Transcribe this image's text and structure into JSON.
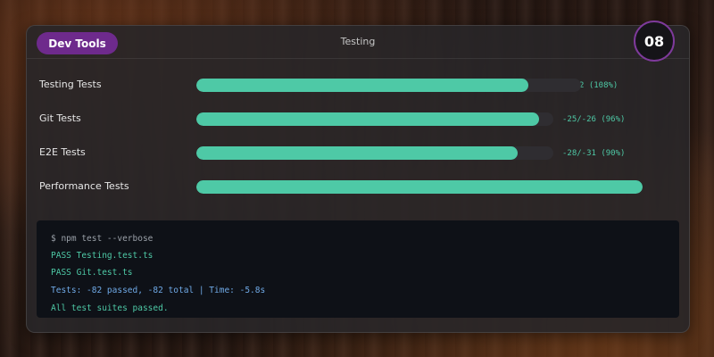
{
  "header": {
    "badge_label": "Dev Tools",
    "title": "Testing",
    "counter": "08"
  },
  "tests": [
    {
      "label": "Testing Tests",
      "fill_fraction": 0.862,
      "value_text": "2 (108%)"
    },
    {
      "label": "Git Tests",
      "fill_fraction": 0.96,
      "value_text": "-25/-26 (96%)"
    },
    {
      "label": "E2E Tests",
      "fill_fraction": 0.9,
      "value_text": "-28/-31 (90%)"
    },
    {
      "label": "Performance Tests",
      "fill_fraction": 1.0,
      "value_text": ""
    }
  ],
  "terminal": {
    "lines": [
      {
        "text": "$ npm test --verbose",
        "color": "#9aa0a8"
      },
      {
        "text": "PASS Testing.test.ts",
        "color": "#4ec9a6"
      },
      {
        "text": "PASS Git.test.ts",
        "color": "#4ec9a6"
      },
      {
        "text": "Tests: -82 passed, -82 total | Time: -5.8s",
        "color": "#6fa9e6"
      },
      {
        "text": "All test suites passed.",
        "color": "#4ec9a6"
      }
    ]
  },
  "colors": {
    "accent": "#4ec9a6",
    "badge": "#6e2a8c",
    "counter_ring": "#7e3a9b"
  }
}
